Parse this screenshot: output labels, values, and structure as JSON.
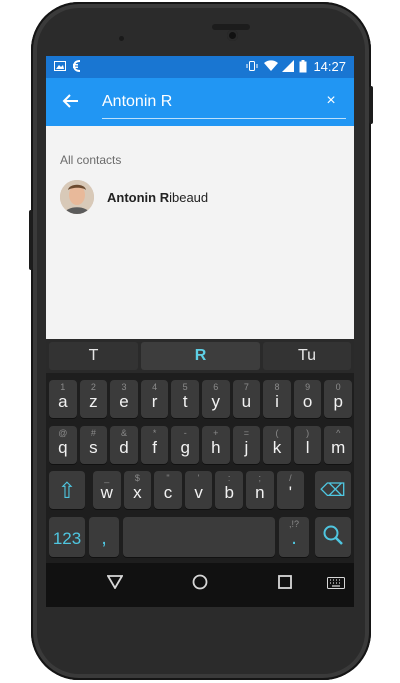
{
  "status_bar": {
    "time": "14:27",
    "icons": [
      "image-icon",
      "app-icon",
      "vibrate-icon",
      "wifi-icon",
      "signal-icon",
      "battery-icon"
    ]
  },
  "search": {
    "query": "Antonin R",
    "back_icon": "←",
    "clear_icon": "×"
  },
  "contacts": {
    "section_label": "All contacts",
    "items": [
      {
        "name_match": "Antonin R",
        "name_rest": "ibeaud"
      }
    ]
  },
  "keyboard": {
    "suggestions": [
      "T",
      "R",
      "Tu"
    ],
    "row1": [
      {
        "main": "a",
        "alt": "1"
      },
      {
        "main": "z",
        "alt": "2"
      },
      {
        "main": "e",
        "alt": "3"
      },
      {
        "main": "r",
        "alt": "4"
      },
      {
        "main": "t",
        "alt": "5"
      },
      {
        "main": "y",
        "alt": "6"
      },
      {
        "main": "u",
        "alt": "7"
      },
      {
        "main": "i",
        "alt": "8"
      },
      {
        "main": "o",
        "alt": "9"
      },
      {
        "main": "p",
        "alt": "0"
      }
    ],
    "row2": [
      {
        "main": "q",
        "alt": "@"
      },
      {
        "main": "s",
        "alt": "#"
      },
      {
        "main": "d",
        "alt": "&"
      },
      {
        "main": "f",
        "alt": "*"
      },
      {
        "main": "g",
        "alt": "-"
      },
      {
        "main": "h",
        "alt": "+"
      },
      {
        "main": "j",
        "alt": "="
      },
      {
        "main": "k",
        "alt": "("
      },
      {
        "main": "l",
        "alt": ")"
      },
      {
        "main": "m",
        "alt": "^"
      }
    ],
    "row3": [
      {
        "main": "w",
        "alt": "_"
      },
      {
        "main": "x",
        "alt": "$"
      },
      {
        "main": "c",
        "alt": "\""
      },
      {
        "main": "v",
        "alt": "'"
      },
      {
        "main": "b",
        "alt": ":"
      },
      {
        "main": "n",
        "alt": ";"
      },
      {
        "main": "'",
        "alt": "/"
      }
    ],
    "shift_icon": "⇧",
    "backspace_icon": "⌫",
    "numbers_label": "123",
    "comma_label": ",",
    "period_label": ".",
    "period_alt": ",!?",
    "search_icon": "⌕"
  },
  "nav": {
    "back_icon": "▽",
    "home_icon": "○",
    "recents_icon": "□",
    "keyboard_icon": "⌨"
  },
  "colors": {
    "status_bar": "#1976d2",
    "app_bar": "#2196f3",
    "accent": "#4fc6e0"
  }
}
